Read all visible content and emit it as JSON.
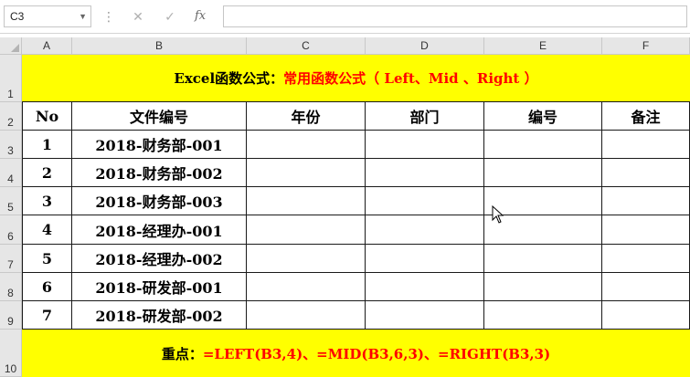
{
  "name_box": "C3",
  "formula_bar": {
    "value": ""
  },
  "columns": [
    "A",
    "B",
    "C",
    "D",
    "E",
    "F"
  ],
  "rows": [
    "1",
    "2",
    "3",
    "4",
    "5",
    "6",
    "7",
    "8",
    "9",
    "10"
  ],
  "title": {
    "prefix": "Excel函数公式：",
    "highlight": "常用函数公式（ Left、Mid 、Right ）"
  },
  "table": {
    "headers": [
      "No",
      "文件编号",
      "年份",
      "部门",
      "编号",
      "备注"
    ],
    "rows": [
      [
        "1",
        "2018-财务部-001"
      ],
      [
        "2",
        "2018-财务部-002"
      ],
      [
        "3",
        "2018-财务部-003"
      ],
      [
        "4",
        "2018-经理办-001"
      ],
      [
        "5",
        "2018-经理办-002"
      ],
      [
        "6",
        "2018-研发部-001"
      ],
      [
        "7",
        "2018-研发部-002"
      ]
    ]
  },
  "footer": {
    "prefix": "重点：",
    "highlight": "=LEFT(B3,4)、=MID(B3,6,3)、=RIGHT(B3,3)"
  },
  "colors": {
    "banner": "#ffff00",
    "accent": "#ff0000",
    "header_bg": "#e6e6e6"
  },
  "icons": [
    "cancel-icon",
    "confirm-icon",
    "function-icon",
    "dropdown-icon"
  ]
}
